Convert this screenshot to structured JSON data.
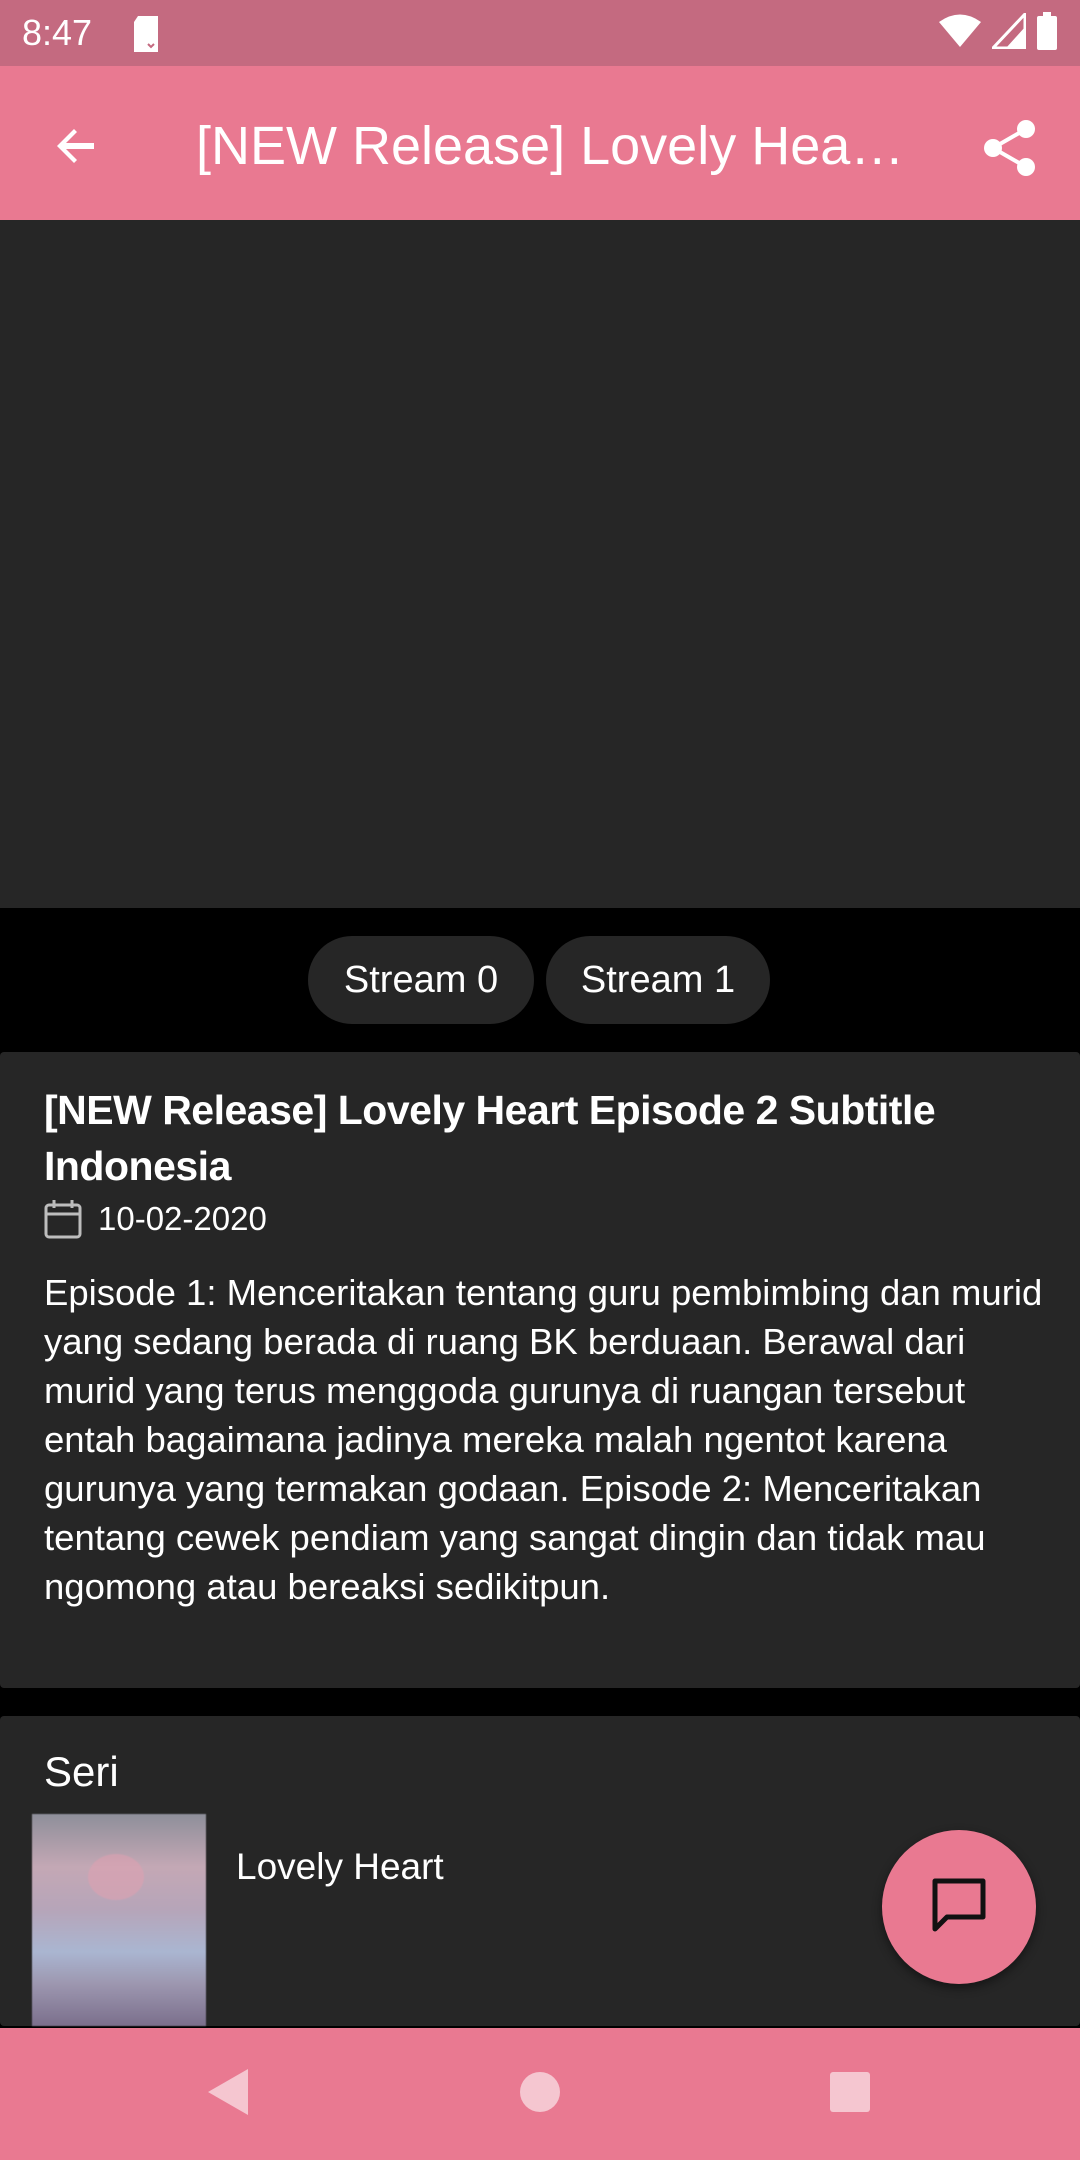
{
  "status_bar": {
    "time": "8:47",
    "icons": [
      "sd-card-icon",
      "wifi-icon",
      "signal-icon",
      "battery-icon"
    ]
  },
  "app_bar": {
    "title": "[NEW Release] Lovely Hea…",
    "back_icon": "arrow-back-icon",
    "share_icon": "share-icon"
  },
  "player": {
    "background": "#262626"
  },
  "streams": [
    {
      "label": "Stream 0"
    },
    {
      "label": "Stream 1"
    }
  ],
  "episode": {
    "title": "[NEW Release] Lovely Heart Episode 2 Subtitle Indonesia",
    "date_icon": "calendar-icon",
    "date": "10-02-2020",
    "description": "Episode 1: Menceritakan tentang guru pembimbing dan murid yang sedang berada di ruang BK berduaan. Berawal dari murid yang terus menggoda gurunya di ruangan tersebut entah bagaimana jadinya mereka malah ngentot karena gurunya yang termakan godaan. Episode 2: Menceritakan tentang cewek pendiam yang sangat dingin dan tidak mau ngomong atau bereaksi sedikitpun."
  },
  "series": {
    "heading": "Seri",
    "items": [
      {
        "name": "Lovely Heart"
      }
    ]
  },
  "fab": {
    "icon": "chat-bubble-icon"
  },
  "nav_bar": {
    "icons": [
      "nav-back-icon",
      "nav-home-icon",
      "nav-recents-icon"
    ]
  },
  "colors": {
    "accent": "#e97991",
    "status_bar": "#c46a80",
    "surface": "#262626",
    "background": "#000000",
    "text": "#ffffff"
  }
}
